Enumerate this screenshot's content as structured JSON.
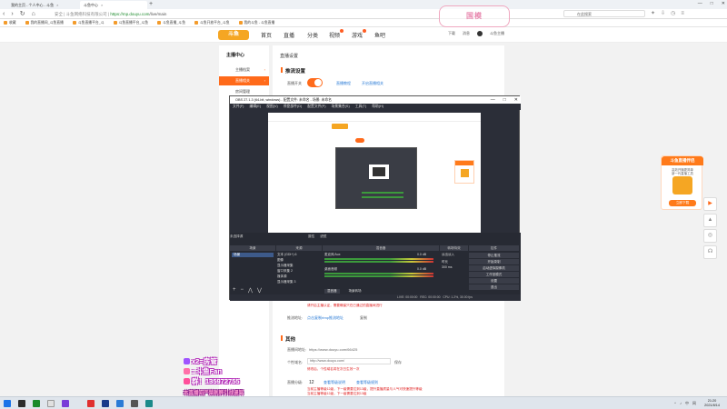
{
  "browser": {
    "tabs": [
      {
        "label": "我的主页 - 个人中心 - 斗鱼",
        "active": false
      },
      {
        "label": "斗鱼中心",
        "active": true
      }
    ],
    "new_tab": "+",
    "window_controls": [
      "—",
      "□",
      "✕"
    ],
    "nav_buttons": [
      "‹",
      "›",
      "↻",
      "⌂"
    ],
    "url_host": "https://mp.douyu.com",
    "url_path": "/live/main",
    "url_prefix": "安全 | 斗鱼网络科技有限公司 |",
    "search_placeholder": "在此搜索",
    "bookmarks": [
      "收藏",
      "我的直播间_斗鱼直播",
      "斗鱼直播平台_斗",
      "斗鱼直播平台_斗鱼",
      "斗鱼直播_斗鱼",
      "斗鱼开放平台_斗鱼",
      "我的斗鱼 - 斗鱼直播"
    ]
  },
  "watermark": "国模",
  "site": {
    "logo": "斗鱼",
    "nav": [
      "首页",
      "直播",
      "分类",
      "视频",
      "游戏",
      "鱼吧"
    ],
    "nav_dots": [
      false,
      false,
      false,
      true,
      true,
      false
    ],
    "header_right": [
      "下载",
      "消息",
      "斗鱼主播"
    ]
  },
  "sidebar": {
    "heading": "主播中心",
    "items": [
      {
        "label": "主播档案",
        "active": false
      },
      {
        "label": "直播相关",
        "active": true
      },
      {
        "label": "房间管理",
        "active": false
      }
    ]
  },
  "main": {
    "title": "直播设置",
    "section_push": "推流设置",
    "live_switch_label": "直播开关",
    "links_top": [
      "直播教程",
      "开启直播相关"
    ],
    "warn_line_1": "请开启主播认证，需要确保只在已通过的直播间进行",
    "link_bottom_label": "推流地址:",
    "link_bottom_value": "点击复制rtmp推流地址",
    "link_bottom_btn": "复制",
    "section_other": "其他",
    "room_url_label": "直播间地址:",
    "room_url_value": "https://www.douyu.com/66425",
    "custom_url_label": "个性域名:",
    "custom_url_value": "http://www.douyu.com/",
    "custom_url_btn": "保存",
    "custom_url_note": "修改后，个性域名将在次日生效一次",
    "level_label": "直播分级:",
    "level_value": "12",
    "level_links": [
      "查看等级说明",
      "查看等级规则"
    ],
    "level_note": "当前主播等级12级，下一级需要达到13级，提升直播质量与人气可快速提升等级",
    "level_note_2": "当前主播等级12级，下一级需要达到13级"
  },
  "obs": {
    "title": "OBS 27.1.3 (64-bit, windows) - 配置文件: 未命名 - 场景: 未命名",
    "menu": [
      "文件(F)",
      "编辑(E)",
      "视图(V)",
      "停靠部件(D)",
      "配置文件(P)",
      "场景集合(S)",
      "工具(T)",
      "帮助(H)"
    ],
    "toolbar_label": "未选择源",
    "toolbar_buttons": [
      "属性",
      "滤镜"
    ],
    "panels": [
      "场景",
      "来源",
      "混音器",
      "转场特效",
      "控件"
    ],
    "scene": "场景",
    "sources": [
      "文本 (GDI+) 6",
      "图像",
      "显示器采集",
      "窗口采集 2",
      "媒体源",
      "显示器采集 3"
    ],
    "mixer": [
      {
        "name": "麦克风/Aux",
        "db": "0.0 dB"
      },
      {
        "name": "桌面音频",
        "db": "0.0 dB"
      }
    ],
    "transition": "淡出淡入",
    "transition_duration_label": "时长",
    "transition_duration": "300 ms",
    "controls": [
      "停止推流",
      "开始录制",
      "启动虚拟摄像机",
      "工作室模式",
      "设置",
      "退出"
    ],
    "status_live": "LIVE: 00:00:00",
    "status_rec": "REC: 00:00:00",
    "status_cpu": "CPU: 1.2%, 30.00 fps",
    "tabs_bottom": [
      "混音器",
      "场景转场"
    ]
  },
  "promo": {
    "title": "斗鱼直播伴侣",
    "desc": "高效开播更简单",
    "desc2": "新一代直播工具",
    "button": "立即下载"
  },
  "right_buttons": [
    "▶",
    "▲",
    "◎",
    "☊"
  ],
  "overlay": {
    "line1": "x2=房管",
    "line2": ": 斗鱼Fan",
    "line3": "群：135972755",
    "line4": "本直播间严禁刷屏引战谩骂"
  },
  "taskbar": {
    "icon_colors": [
      "#1a73e8",
      "#2b2b2b",
      "#1a8a2a",
      "#e0e0e0",
      "#7a3cd8",
      "#e03030",
      "#1a3a8a",
      "#2a7bd6",
      "#555555",
      "#1a8a8a"
    ],
    "tray": [
      "^",
      "♪",
      "中",
      "网"
    ],
    "time": "21:20",
    "date": "2021/8/14"
  },
  "colors": {
    "accent": "#ff6a1a",
    "link": "#2a7bd6",
    "warning": "#e02020"
  }
}
